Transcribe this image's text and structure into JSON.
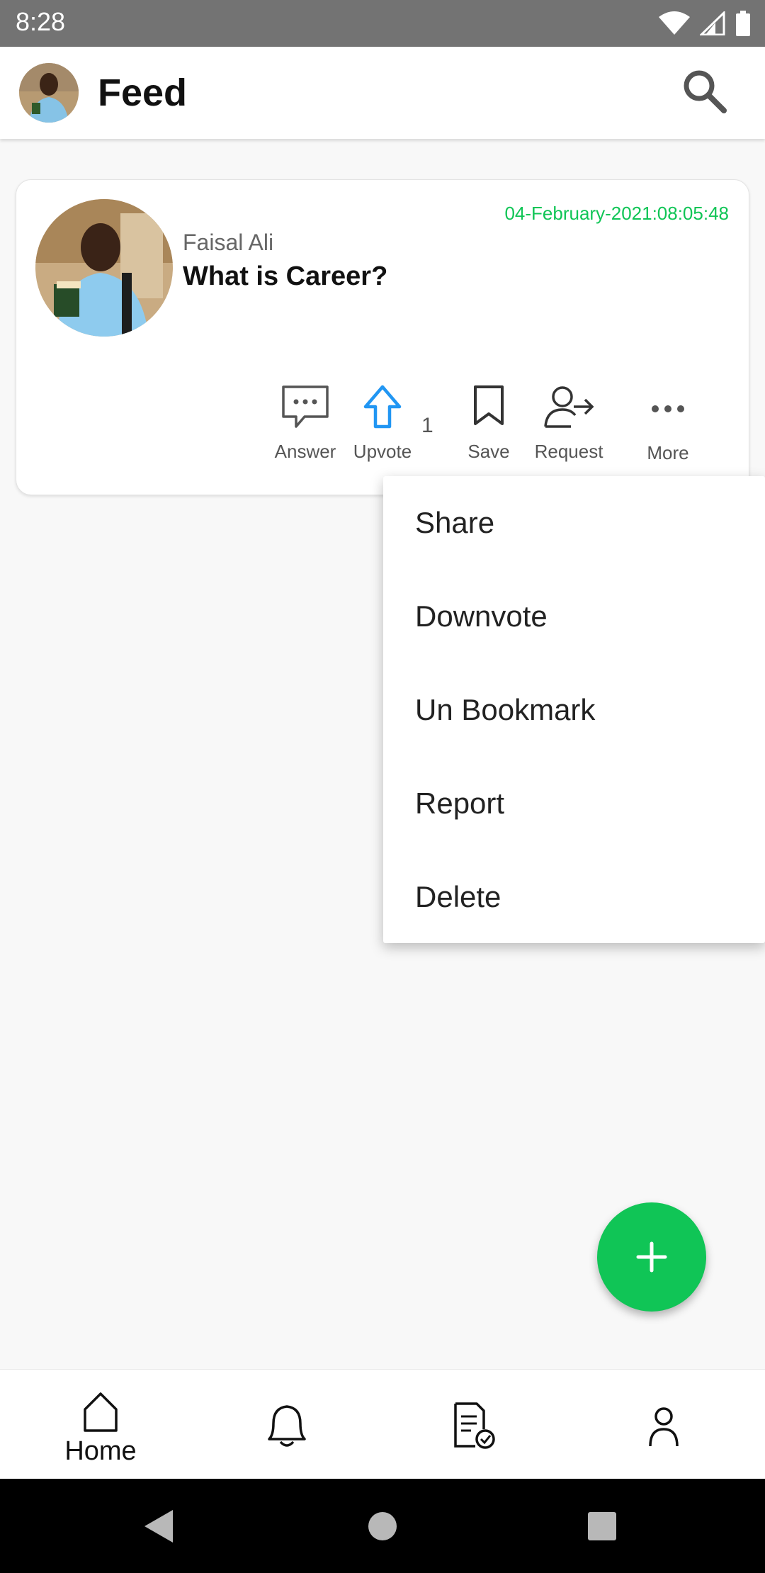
{
  "status_bar": {
    "time": "8:28"
  },
  "app_bar": {
    "title": "Feed"
  },
  "post": {
    "timestamp": "04-February-2021:08:05:48",
    "author": "Faisal Ali",
    "question": "What is Career?",
    "actions": {
      "answer": "Answer",
      "upvote": "Upvote",
      "upvote_count": "1",
      "save": "Save",
      "request": "Request",
      "more": "More"
    }
  },
  "menu": {
    "items": [
      "Share",
      "Downvote",
      "Un Bookmark",
      "Report",
      "Delete"
    ]
  },
  "bottom_nav": {
    "home": "Home"
  },
  "colors": {
    "accent": "#10c556",
    "upvote": "#2196f3",
    "status_bar": "#737373"
  },
  "icons": [
    "search-icon",
    "comment-icon",
    "upvote-arrow-icon",
    "bookmark-icon",
    "request-user-icon",
    "more-dots-icon",
    "plus-icon",
    "home-icon",
    "bell-icon",
    "document-check-icon",
    "person-icon",
    "back-icon",
    "home-circle-icon",
    "recents-icon"
  ]
}
